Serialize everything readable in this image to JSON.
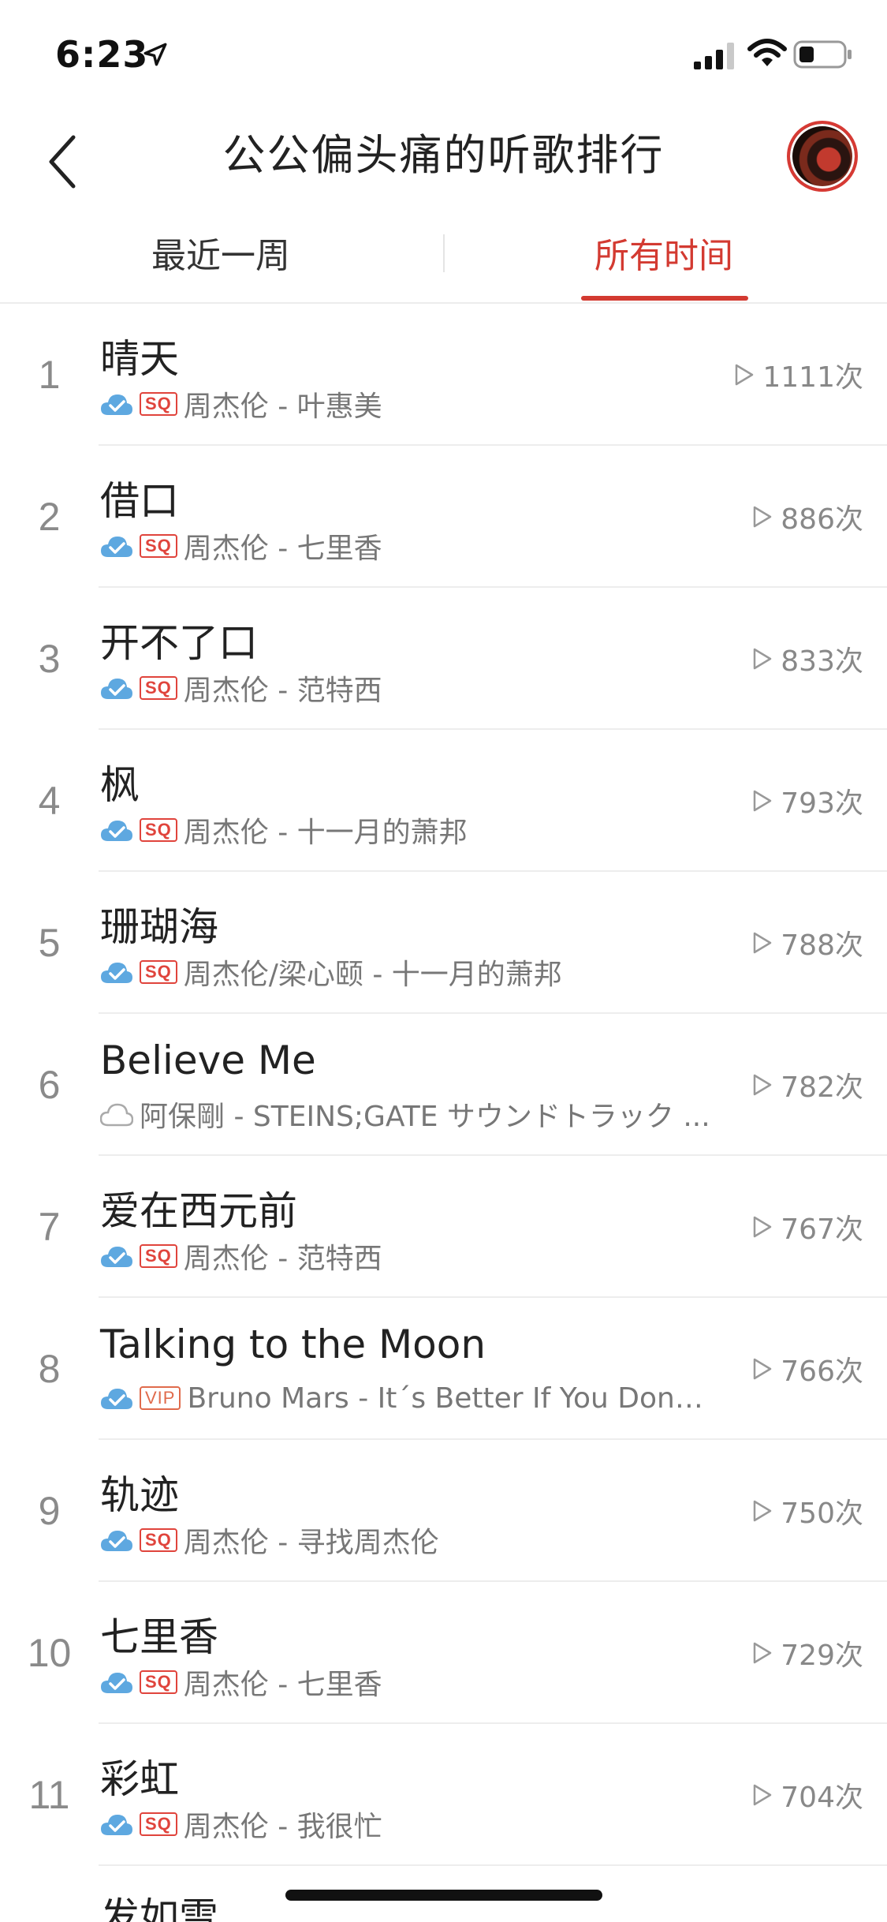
{
  "status_bar": {
    "time": "6:23"
  },
  "header": {
    "title": "公公偏头痛的听歌排行"
  },
  "tabs": [
    {
      "label": "最近一周",
      "active": false
    },
    {
      "label": "所有时间",
      "active": true
    }
  ],
  "accent_color": "#d33a31",
  "songs": [
    {
      "rank": "1",
      "title": "晴天",
      "badge": "SQ",
      "cloud": "uploaded",
      "meta": "周杰伦 - 叶惠美",
      "plays": "1111次"
    },
    {
      "rank": "2",
      "title": "借口",
      "badge": "SQ",
      "cloud": "uploaded",
      "meta": "周杰伦 - 七里香",
      "plays": "886次"
    },
    {
      "rank": "3",
      "title": "开不了口",
      "badge": "SQ",
      "cloud": "uploaded",
      "meta": "周杰伦 - 范特西",
      "plays": "833次"
    },
    {
      "rank": "4",
      "title": "枫",
      "badge": "SQ",
      "cloud": "uploaded",
      "meta": "周杰伦 - 十一月的萧邦",
      "plays": "793次"
    },
    {
      "rank": "5",
      "title": "珊瑚海",
      "badge": "SQ",
      "cloud": "uploaded",
      "meta": "周杰伦/梁心颐 - 十一月的萧邦",
      "plays": "788次"
    },
    {
      "rank": "6",
      "title": "Believe Me",
      "badge": "",
      "cloud": "outline",
      "meta": "阿保剛 - STEINS;GATE サウンドトラック ...",
      "plays": "782次"
    },
    {
      "rank": "7",
      "title": "爱在西元前",
      "badge": "SQ",
      "cloud": "uploaded",
      "meta": "周杰伦 - 范特西",
      "plays": "767次"
    },
    {
      "rank": "8",
      "title": "Talking to the Moon",
      "badge": "VIP",
      "cloud": "uploaded",
      "meta": "Bruno Mars - It´s Better If You Don´t...",
      "plays": "766次"
    },
    {
      "rank": "9",
      "title": "轨迹",
      "badge": "SQ",
      "cloud": "uploaded",
      "meta": "周杰伦 - 寻找周杰伦",
      "plays": "750次"
    },
    {
      "rank": "10",
      "title": "七里香",
      "badge": "SQ",
      "cloud": "uploaded",
      "meta": "周杰伦 - 七里香",
      "plays": "729次"
    },
    {
      "rank": "11",
      "title": "彩虹",
      "badge": "SQ",
      "cloud": "uploaded",
      "meta": "周杰伦 - 我很忙",
      "plays": "704次"
    }
  ],
  "partial_song": {
    "title": "发如雪"
  }
}
